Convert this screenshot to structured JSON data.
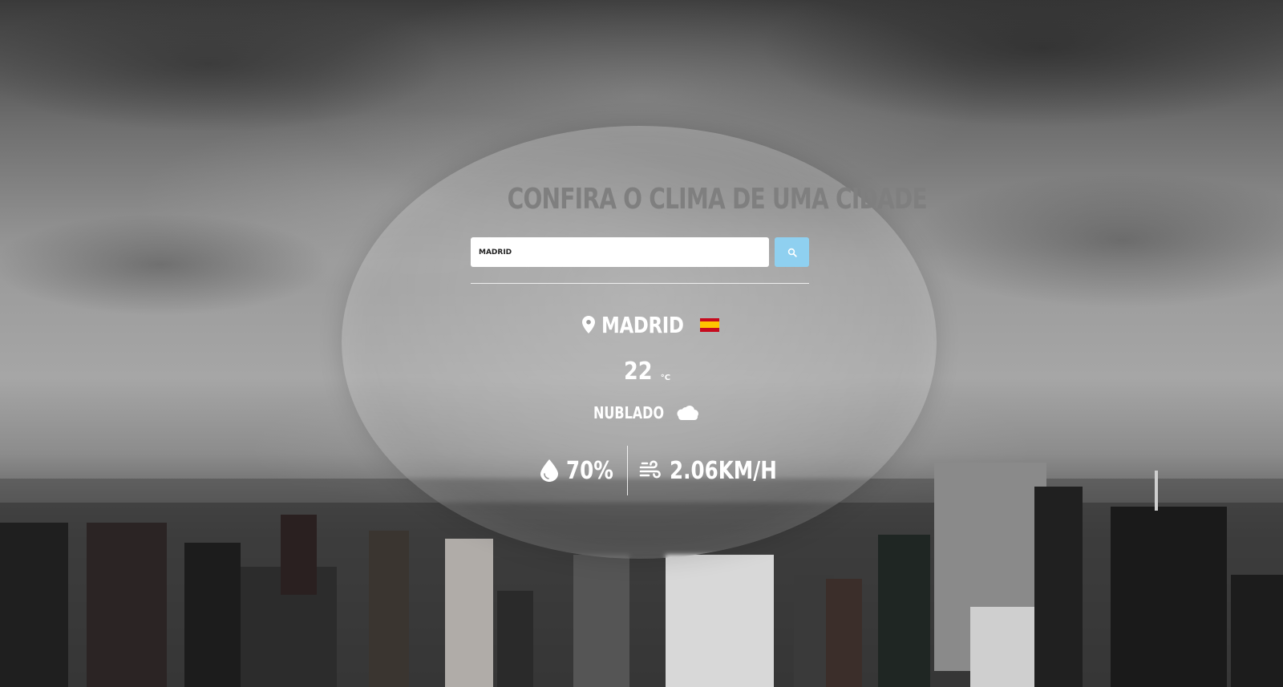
{
  "header": {
    "title": "CONFIRA O CLIMA DE UMA CIDADE"
  },
  "search": {
    "value": "MADRID",
    "placeholder": "",
    "button_icon": "search-icon",
    "button_color": "#8fd0f0"
  },
  "weather": {
    "city": "MADRID",
    "country_flag": "spain-flag-icon",
    "temperature": "22",
    "unit": "°C",
    "condition": "NUBLADO",
    "condition_icon": "cloud-icon",
    "humidity": "70%",
    "humidity_icon": "water-drop-icon",
    "wind": "2.06KM/H",
    "wind_icon": "wind-icon",
    "location_icon": "map-pin-icon"
  },
  "colors": {
    "title": "#7f7f7f",
    "text": "#ffffff"
  }
}
